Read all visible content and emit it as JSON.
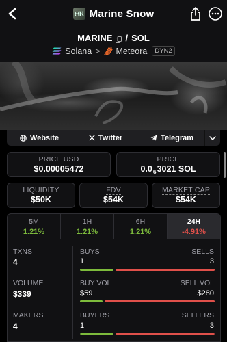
{
  "nav": {
    "title": "Marine Snow",
    "logo_text": "ⲘⲚ"
  },
  "header": {
    "base_symbol": "MARINE",
    "separator": "/",
    "quote_symbol": "SOL",
    "chain": "Solana",
    "arrow": ">",
    "dex": "Meteora",
    "dex_badge": "DYN2"
  },
  "links": {
    "website": "Website",
    "twitter": "Twitter",
    "telegram": "Telegram"
  },
  "price_usd": {
    "label": "PRICE USD",
    "value": "$0.00005472"
  },
  "price_native": {
    "label": "PRICE",
    "prefix": "0.0",
    "zeros": "6",
    "digits": "3021",
    "unit": "SOL"
  },
  "liquidity": {
    "label": "LIQUIDITY",
    "value": "$50K"
  },
  "fdv": {
    "label": "FDV",
    "value": "$54K"
  },
  "market_cap": {
    "label": "MARKET CAP",
    "value": "$54K"
  },
  "tabs": [
    {
      "label": "5M",
      "value": "1.21%",
      "color": "#7dbb3c"
    },
    {
      "label": "1H",
      "value": "1.21%",
      "color": "#7dbb3c"
    },
    {
      "label": "6H",
      "value": "1.21%",
      "color": "#7dbb3c"
    },
    {
      "label": "24H",
      "value": "-4.91%",
      "color": "#e0504a"
    }
  ],
  "stats": {
    "txns": {
      "label": "TXNS",
      "value": "4"
    },
    "volume": {
      "label": "VOLUME",
      "value": "$339"
    },
    "makers": {
      "label": "MAKERS",
      "value": "4"
    },
    "buys": {
      "label": "BUYS",
      "value": "1",
      "fraction": 0.25
    },
    "sells": {
      "label": "SELLS",
      "value": "3"
    },
    "buy_vol": {
      "label": "BUY VOL",
      "value": "$59",
      "fraction": 0.17
    },
    "sell_vol": {
      "label": "SELL VOL",
      "value": "$280"
    },
    "buyers": {
      "label": "BUYERS",
      "value": "1",
      "fraction": 0.25
    },
    "sellers": {
      "label": "SELLERS",
      "value": "3"
    }
  },
  "colors": {
    "green": "#7dbb3c",
    "red": "#e0504a",
    "background": "#000000",
    "card": "#111113"
  },
  "icons": [
    "back-icon",
    "share-icon",
    "more-icon",
    "copy-icon",
    "solana-icon",
    "meteora-icon",
    "globe-icon",
    "x-icon",
    "telegram-icon",
    "chevron-down-icon"
  ]
}
